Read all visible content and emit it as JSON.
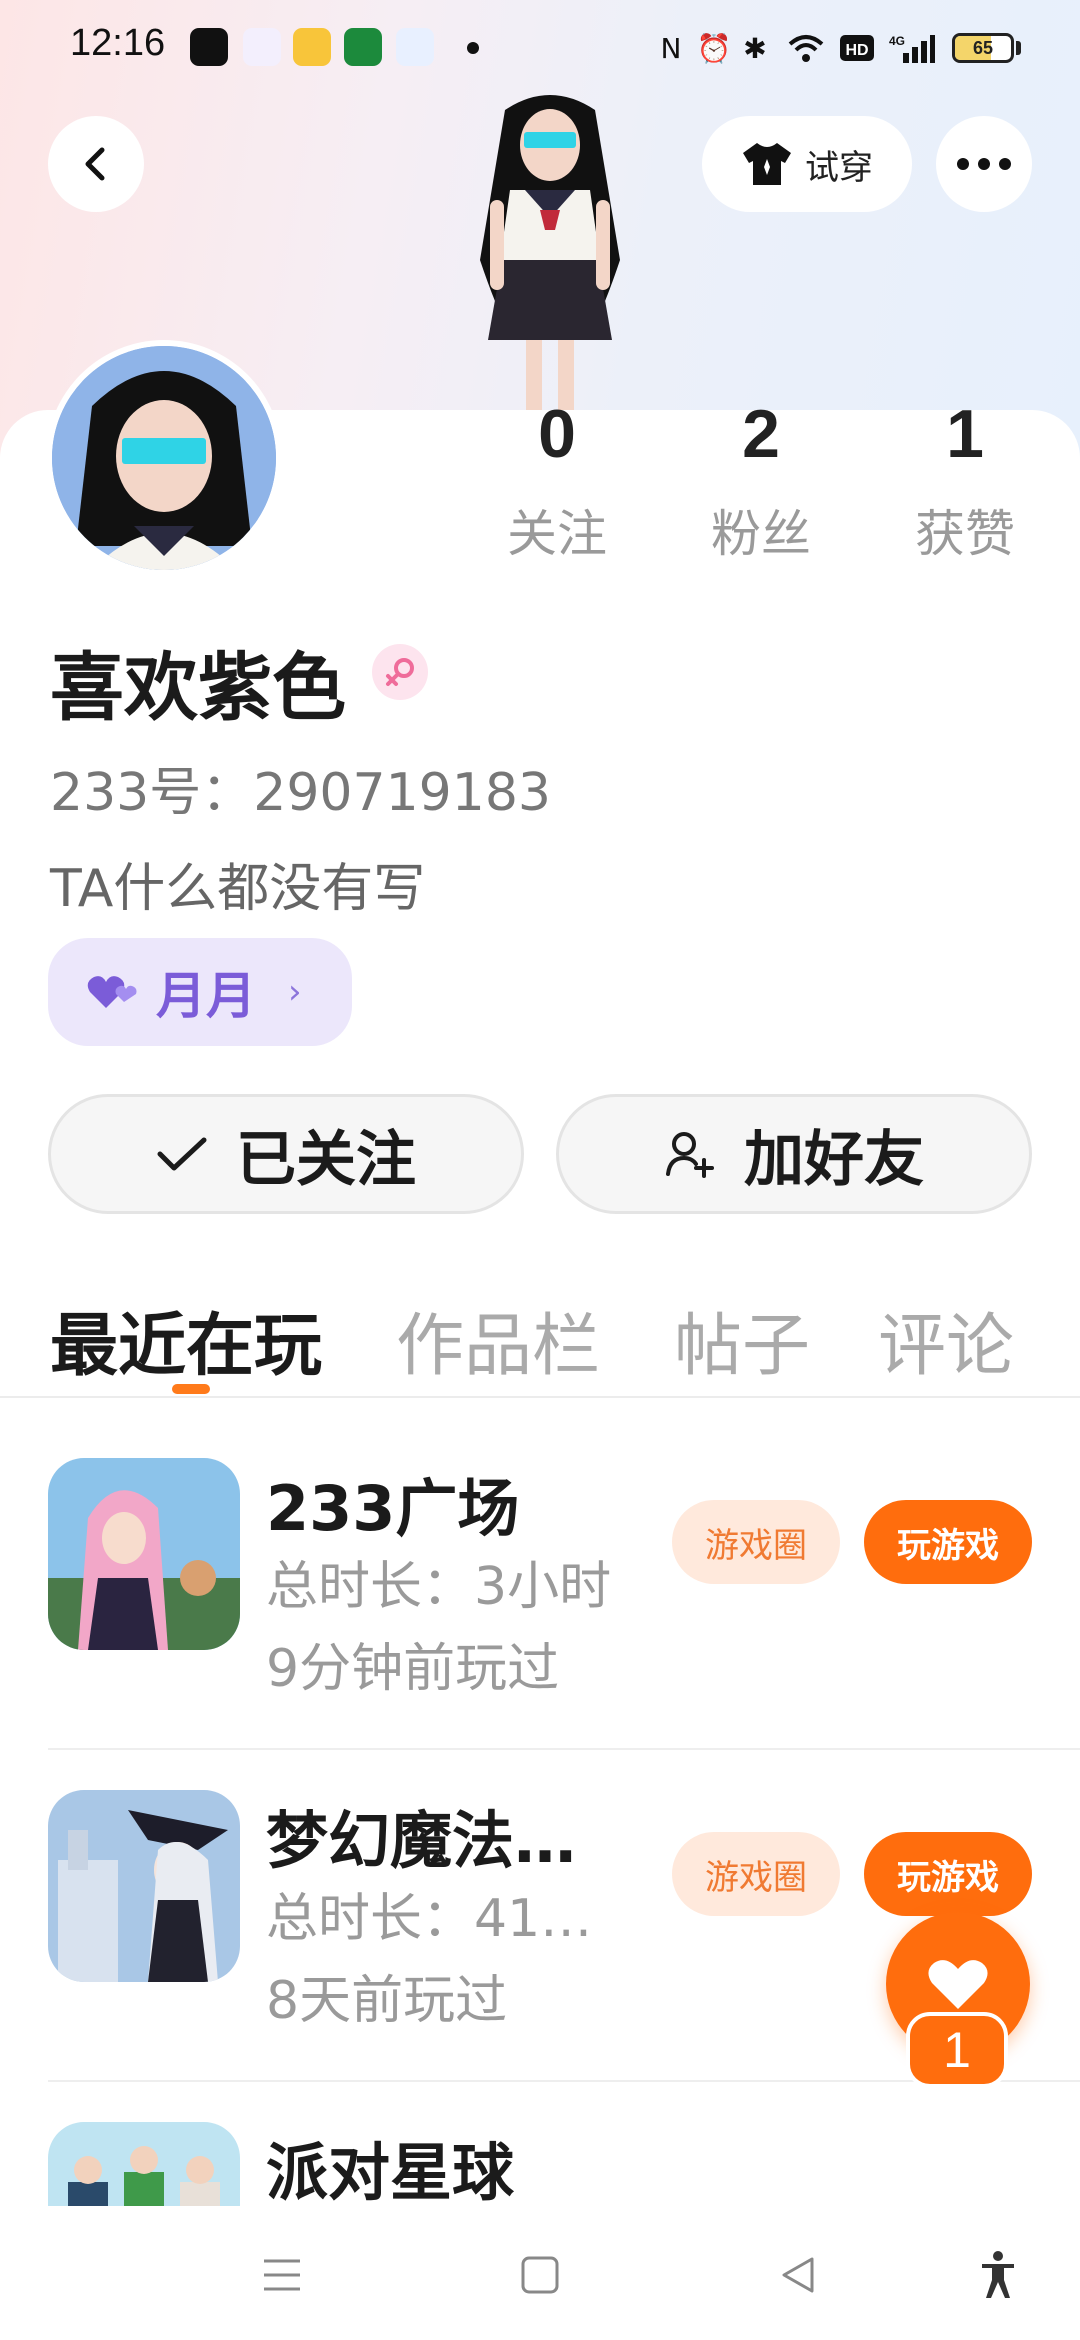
{
  "status_bar": {
    "time": "12:16",
    "battery_level": "65",
    "battery_fraction": 0.65
  },
  "header": {
    "try_on_label": "试穿"
  },
  "profile": {
    "stats": [
      {
        "value": "0",
        "label": "关注"
      },
      {
        "value": "2",
        "label": "粉丝"
      },
      {
        "value": "1",
        "label": "获赞"
      }
    ],
    "username": "喜欢紫色",
    "uid_text": "233号：290719183",
    "bio": "TA什么都没有写",
    "cp_tag": "月月",
    "follow_label": "已关注",
    "add_friend_label": "加好友"
  },
  "tabs": [
    {
      "label": "最近在玩",
      "active": true
    },
    {
      "label": "作品栏",
      "active": false
    },
    {
      "label": "帖子",
      "active": false
    },
    {
      "label": "评论",
      "active": false
    }
  ],
  "games": [
    {
      "name": "233广场",
      "duration": "总时长：3小时",
      "last_played": "9分钟前玩过",
      "circle_label": "游戏圈",
      "play_label": "玩游戏"
    },
    {
      "name": "梦幻魔法…",
      "duration": "总时长：41…",
      "last_played": "8天前玩过",
      "circle_label": "游戏圈",
      "play_label": "玩游戏"
    },
    {
      "name": "派对星球",
      "duration": "",
      "last_played": "",
      "circle_label": "",
      "play_label": ""
    }
  ],
  "floating_like": {
    "count": "1"
  },
  "colors": {
    "accent": "#ff6d0d",
    "cp_purple": "#7b5cd8"
  }
}
